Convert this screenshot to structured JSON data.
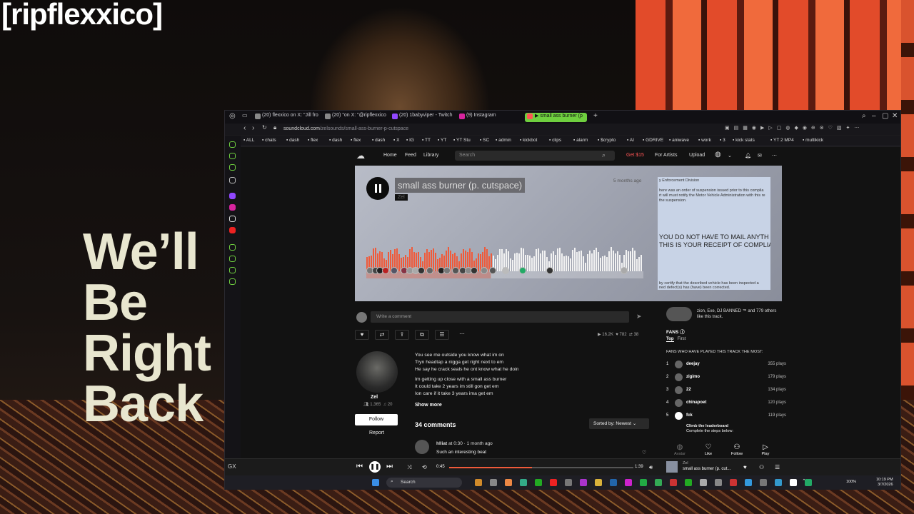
{
  "overlay": {
    "channel": "[ripflexxico]",
    "brb_lines": [
      "We’ll",
      "Be",
      "Right",
      "Back"
    ]
  },
  "browser": {
    "tabs": [
      {
        "label": "(20) flexxico on X: \"Jill fro",
        "color": "#888"
      },
      {
        "label": "(20) \"on X: \"@ripflexxico",
        "color": "#888"
      },
      {
        "label": "(20) 1babyviper - Twitch",
        "color": "#9147ff"
      },
      {
        "label": "(9) Instagram",
        "color": "#d6249f"
      },
      {
        "label": "▶ small ass burner (p",
        "color": "#f55"
      }
    ],
    "url_host": "soundcloud.com",
    "url_path": "/zelsounds/small-ass-burner-p-cutspace",
    "bookmarks": [
      "ALL",
      "chats",
      "dash",
      "flex",
      "dash",
      "flex",
      "dash",
      "X",
      "IG",
      "TT",
      "YT",
      "YT Stu",
      "SC",
      "admin",
      "kickbot",
      "clips",
      "alarm",
      "$crypto",
      "AI",
      "GDRIVE",
      "aniwave",
      "work",
      "3",
      "kick stats",
      "YT 2 MP4",
      "multikick"
    ]
  },
  "soundcloud": {
    "nav": {
      "home": "Home",
      "feed": "Feed",
      "library": "Library",
      "search_placeholder": "Search",
      "get_pro": "Get $15",
      "for_artists": "For Artists",
      "upload": "Upload"
    },
    "track": {
      "title": "small ass burner (p. cutspace)",
      "artist": "Zel",
      "posted": "5 months ago",
      "position": "0:45",
      "duration": "1:39",
      "progress": 0.45
    },
    "artwork_text": {
      "top": "y Enforcement Division",
      "line1": "here was an order of suspension issued prior to this complia",
      "line2": "rt will must notify the Motor Vehicle Administration with this re",
      "line3": "the suspension.",
      "big1": "YOU DO NOT HAVE TO MAIL ANYTH",
      "big2": "THIS IS YOUR RECEIPT OF COMPLIA",
      "bottom1": "by certify that the described vehicle has been inspected a",
      "bottom2": "ned defect(s) has (have) been corrected."
    },
    "comment_placeholder": "Write a comment",
    "stats": {
      "plays": "16.2K",
      "likes": "782",
      "reposts": "38"
    },
    "uploader": {
      "name": "Zel",
      "followers": "1,365",
      "tracks": "20",
      "follow": "Follow",
      "report": "Report"
    },
    "lyrics": [
      "You see me outside you know what im on",
      "Tryn headtap a nigga get right next to em",
      "He say he crack seals he ont know what he doin",
      "",
      "Im getting up close with a small ass burner",
      "It could take 2 years im still gon get em",
      "Ion care if it take 3 years ima get em"
    ],
    "show_more": "Show more",
    "comments_count": "34 comments",
    "sort": "Sorted by: Newest",
    "first_comment": {
      "user": "hlliat",
      "at": "at 0:30",
      "ago": "1 month ago",
      "text": "Such an interesting beat"
    },
    "likers": "zion, Exe, DJ BANNED ™ and 779 others like this track.",
    "fans": {
      "title": "FANS",
      "tab_top": "Top",
      "tab_first": "First",
      "header": "FANS WHO HAVE PLAYED THIS TRACK THE MOST:",
      "list": [
        {
          "rank": "1",
          "user": "deejay",
          "plays": "355 plays"
        },
        {
          "rank": "2",
          "user": "zigimo",
          "plays": "179 plays"
        },
        {
          "rank": "3",
          "user": "22",
          "plays": "134 plays"
        },
        {
          "rank": "4",
          "user": "chinapoet",
          "plays": "120 plays"
        },
        {
          "rank": "5",
          "user": "fck",
          "plays": "119 plays"
        }
      ],
      "climb1": "Climb the leaderboard",
      "climb2": "Complete the steps below:",
      "buttons": [
        "Like",
        "Follow",
        "Play"
      ],
      "avatar_label": "Avatar"
    }
  },
  "player": {
    "now_artist": "Zel",
    "now_title": "small ass burner (p. cut..."
  },
  "taskbar": {
    "search": "Search",
    "time": "10:19 PM",
    "date": "3/7/2026",
    "battery": "100%"
  }
}
